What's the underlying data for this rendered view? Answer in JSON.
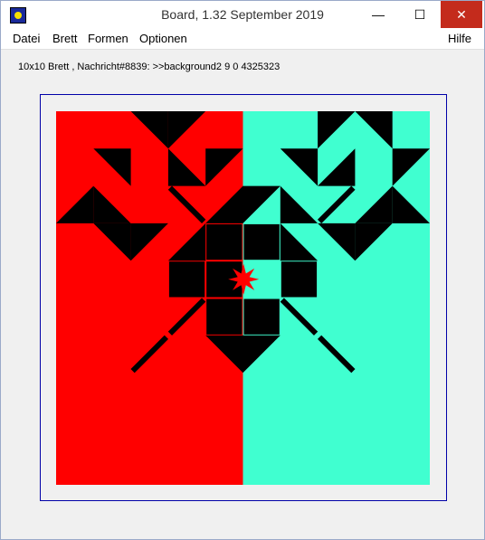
{
  "window": {
    "title": "Board, 1.32   September 2019",
    "minimize_glyph": "—",
    "maximize_glyph": "☐",
    "close_glyph": "✕"
  },
  "menu": {
    "datei": "Datei",
    "brett": "Brett",
    "formen": "Formen",
    "optionen": "Optionen",
    "hilfe": "Hilfe"
  },
  "status": {
    "text": "10x10 Brett , Nachricht#8839:  >>background2 9 0 4325323"
  },
  "board": {
    "rows": 10,
    "cols": 10,
    "colors": {
      "left": "#ff0000",
      "right": "#40ffd0",
      "piece": "#000000",
      "star": "#ff0000",
      "frame": "#0000a8"
    },
    "shapes": [
      {
        "r": 0,
        "c": 2,
        "t": "tri",
        "o": "tr"
      },
      {
        "r": 0,
        "c": 3,
        "t": "tri",
        "o": "tl"
      },
      {
        "r": 1,
        "c": 1,
        "t": "tri",
        "o": "tr"
      },
      {
        "r": 1,
        "c": 3,
        "t": "tri",
        "o": "bl"
      },
      {
        "r": 1,
        "c": 4,
        "t": "tri",
        "o": "tl"
      },
      {
        "r": 2,
        "c": 0,
        "t": "tri",
        "o": "br"
      },
      {
        "r": 2,
        "c": 1,
        "t": "tri",
        "o": "bl"
      },
      {
        "r": 2,
        "c": 3,
        "t": "diag",
        "o": "tl"
      },
      {
        "r": 2,
        "c": 4,
        "t": "tri",
        "o": "br"
      },
      {
        "r": 2,
        "c": 5,
        "t": "tri",
        "o": "tl"
      },
      {
        "r": 3,
        "c": 1,
        "t": "tri",
        "o": "tr"
      },
      {
        "r": 3,
        "c": 2,
        "t": "tri",
        "o": "tl"
      },
      {
        "r": 3,
        "c": 3,
        "t": "tri",
        "o": "br"
      },
      {
        "r": 3,
        "c": 4,
        "t": "sq"
      },
      {
        "r": 3,
        "c": 5,
        "t": "sq"
      },
      {
        "r": 3,
        "c": 6,
        "t": "tri",
        "o": "bl"
      },
      {
        "r": 4,
        "c": 3,
        "t": "sq"
      },
      {
        "r": 4,
        "c": 4,
        "t": "sq"
      },
      {
        "r": 4,
        "c": 6,
        "t": "sq"
      },
      {
        "r": 5,
        "c": 3,
        "t": "diag",
        "o": "tr"
      },
      {
        "r": 5,
        "c": 4,
        "t": "sq"
      },
      {
        "r": 5,
        "c": 5,
        "t": "sq"
      },
      {
        "r": 5,
        "c": 6,
        "t": "diag",
        "o": "tl"
      },
      {
        "r": 6,
        "c": 2,
        "t": "diag",
        "o": "tr"
      },
      {
        "r": 6,
        "c": 4,
        "t": "tri",
        "o": "tr"
      },
      {
        "r": 6,
        "c": 5,
        "t": "tri",
        "o": "tl"
      },
      {
        "r": 6,
        "c": 7,
        "t": "diag",
        "o": "tl"
      },
      {
        "r": 0,
        "c": 7,
        "t": "tri",
        "o": "tl"
      },
      {
        "r": 0,
        "c": 8,
        "t": "tri",
        "o": "tr"
      },
      {
        "r": 1,
        "c": 6,
        "t": "tri",
        "o": "tr"
      },
      {
        "r": 1,
        "c": 7,
        "t": "tri",
        "o": "br"
      },
      {
        "r": 1,
        "c": 9,
        "t": "tri",
        "o": "tl"
      },
      {
        "r": 2,
        "c": 6,
        "t": "tri",
        "o": "bl"
      },
      {
        "r": 2,
        "c": 7,
        "t": "diag",
        "o": "tr"
      },
      {
        "r": 2,
        "c": 8,
        "t": "tri",
        "o": "br"
      },
      {
        "r": 2,
        "c": 9,
        "t": "tri",
        "o": "bl"
      },
      {
        "r": 3,
        "c": 7,
        "t": "tri",
        "o": "tr"
      },
      {
        "r": 3,
        "c": 8,
        "t": "tri",
        "o": "tl"
      }
    ],
    "star_cell": {
      "r": 4,
      "c": 5
    }
  }
}
